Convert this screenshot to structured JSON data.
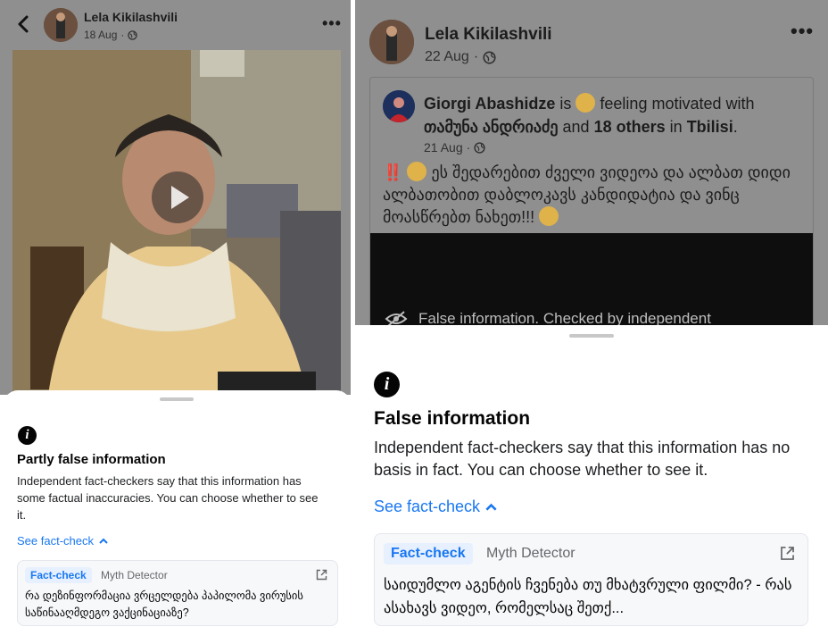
{
  "left": {
    "author": "Lela Kikilashvili",
    "time": "18 Aug",
    "more": "•••",
    "sheet": {
      "title": "Partly false information",
      "description": "Independent fact-checkers say that this information has some factual inaccuracies. You can choose whether to see it.",
      "see_fact_check": "See fact-check",
      "card": {
        "badge": "Fact-check",
        "source": "Myth Detector",
        "headline": "რა დეზინფორმაცია ვრცელდება პაპილომა ვირუსის საწინააღმდეგო ვაქცინაციაზე?"
      }
    }
  },
  "right": {
    "author": "Lela Kikilashvili",
    "time": "22 Aug",
    "more": "•••",
    "shared": {
      "author": "Giorgi Abashidze",
      "is": "is",
      "feeling": "feeling motivated with",
      "with_name": "თამუნა ანდრიაძე",
      "and": "and",
      "others": "18 others",
      "in": "in",
      "place": "Tbilisi",
      "dot": ".",
      "time": "21 Aug",
      "text_marks": "‼️",
      "text": "ეს შედარებით ძველი ვიდეოა და ალბათ დიდი ალბათობით დაბლოკავს კანდიდატია და ვინც მოასწრებთ ნახეთ!!!",
      "banner": "False information. Checked by independent"
    },
    "sheet": {
      "title": "False information",
      "description": "Independent fact-checkers say that this information has no basis in fact. You can choose whether to see it.",
      "see_fact_check": "See fact-check",
      "card": {
        "badge": "Fact-check",
        "source": "Myth Detector",
        "headline": "საიდუმლო აგენტის ჩვენება თუ მხატვრული ფილმი? - რას ასახავს ვიდეო, რომელსაც შეთქ..."
      }
    }
  },
  "icons": {
    "info": "i",
    "chevron_up": "chevron-up-icon",
    "external": "external-link-icon",
    "back": "back-arrow-icon",
    "globe": "globe-icon",
    "eye_off": "eye-off-icon"
  },
  "colors": {
    "link": "#1877f2",
    "overlay": "#8f8f8f",
    "badge_bg": "#e7f0fe"
  }
}
